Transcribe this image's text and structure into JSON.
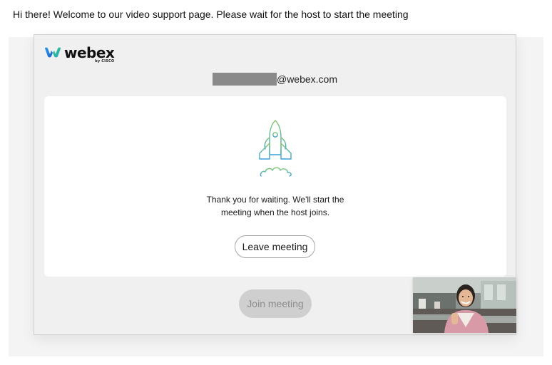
{
  "page": {
    "welcome_text": "Hi there! Welcome to our video support page. Please wait for the host to start the meeting"
  },
  "widget": {
    "logo": {
      "brand": "webex",
      "sub": "by CISCO"
    },
    "user": {
      "email_suffix": "@webex.com",
      "email_prefix_redacted": true
    },
    "waiting": {
      "icon": "rocket-icon",
      "message_line1": "Thank you for waiting. We'll start the",
      "message_line2": "meeting when the host joins."
    },
    "buttons": {
      "leave": "Leave meeting",
      "join": "Join meeting",
      "join_enabled": false
    },
    "self_view": {
      "label": "camera-preview"
    }
  },
  "colors": {
    "frame_background": "#f0f0f0",
    "card_background": "#ffffff",
    "join_disabled_bg": "#cfcfcf",
    "join_disabled_text": "#8c8c8c",
    "rocket_gradient_start": "#7cc47f",
    "rocket_gradient_end": "#3ea6d8",
    "logo_blue": "#1b6fd6",
    "logo_green": "#2fb24a"
  }
}
